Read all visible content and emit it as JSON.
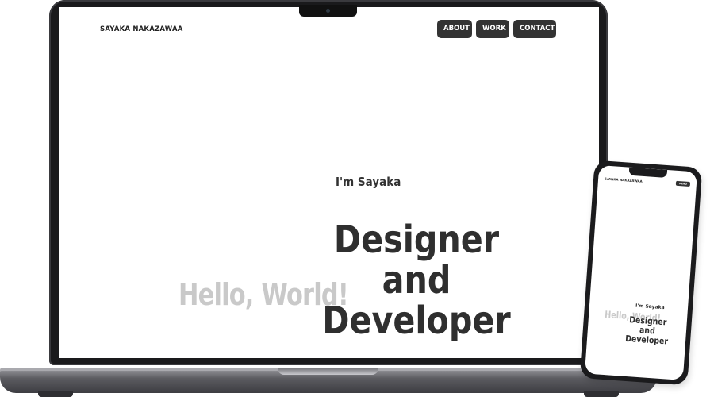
{
  "site": {
    "brand": "SAYAKA NAKAZAWAA",
    "nav": [
      {
        "label": "ABOUT"
      },
      {
        "label": "WORK"
      },
      {
        "label": "CONTACT"
      }
    ]
  },
  "hero": {
    "intro": "I'm Sayaka",
    "background_text": "Hello, World!",
    "headline": [
      "Designer",
      "and",
      "Developer"
    ]
  },
  "mobile": {
    "brand": "SAYAKA NAKAZAWAA",
    "menu_label": "MENU",
    "intro": "I'm Sayaka",
    "background_text": "Hello, World!",
    "headline": [
      "Designer",
      "and",
      "Developer"
    ]
  },
  "colors": {
    "nav_button": "#333333",
    "headline": "#2f2f2f",
    "background_text": "#c9c9c9",
    "device_frame": "#1a1a1c"
  }
}
